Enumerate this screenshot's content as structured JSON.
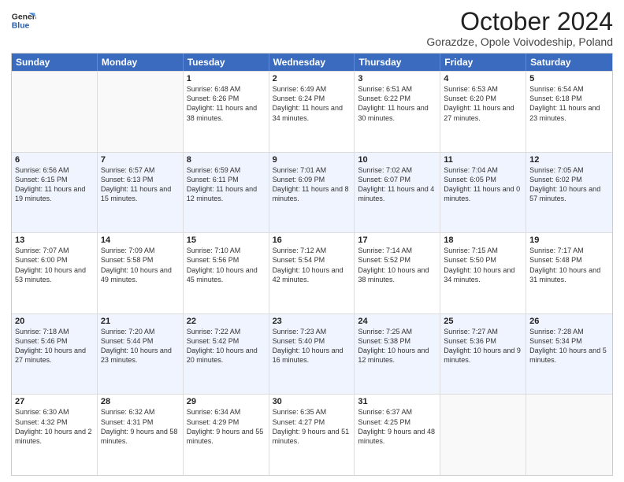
{
  "header": {
    "logo_line1": "General",
    "logo_line2": "Blue",
    "title": "October 2024",
    "subtitle": "Gorazdze, Opole Voivodeship, Poland"
  },
  "days_of_week": [
    "Sunday",
    "Monday",
    "Tuesday",
    "Wednesday",
    "Thursday",
    "Friday",
    "Saturday"
  ],
  "weeks": [
    [
      {
        "day": "",
        "info": ""
      },
      {
        "day": "",
        "info": ""
      },
      {
        "day": "1",
        "info": "Sunrise: 6:48 AM\nSunset: 6:26 PM\nDaylight: 11 hours and 38 minutes."
      },
      {
        "day": "2",
        "info": "Sunrise: 6:49 AM\nSunset: 6:24 PM\nDaylight: 11 hours and 34 minutes."
      },
      {
        "day": "3",
        "info": "Sunrise: 6:51 AM\nSunset: 6:22 PM\nDaylight: 11 hours and 30 minutes."
      },
      {
        "day": "4",
        "info": "Sunrise: 6:53 AM\nSunset: 6:20 PM\nDaylight: 11 hours and 27 minutes."
      },
      {
        "day": "5",
        "info": "Sunrise: 6:54 AM\nSunset: 6:18 PM\nDaylight: 11 hours and 23 minutes."
      }
    ],
    [
      {
        "day": "6",
        "info": "Sunrise: 6:56 AM\nSunset: 6:15 PM\nDaylight: 11 hours and 19 minutes."
      },
      {
        "day": "7",
        "info": "Sunrise: 6:57 AM\nSunset: 6:13 PM\nDaylight: 11 hours and 15 minutes."
      },
      {
        "day": "8",
        "info": "Sunrise: 6:59 AM\nSunset: 6:11 PM\nDaylight: 11 hours and 12 minutes."
      },
      {
        "day": "9",
        "info": "Sunrise: 7:01 AM\nSunset: 6:09 PM\nDaylight: 11 hours and 8 minutes."
      },
      {
        "day": "10",
        "info": "Sunrise: 7:02 AM\nSunset: 6:07 PM\nDaylight: 11 hours and 4 minutes."
      },
      {
        "day": "11",
        "info": "Sunrise: 7:04 AM\nSunset: 6:05 PM\nDaylight: 11 hours and 0 minutes."
      },
      {
        "day": "12",
        "info": "Sunrise: 7:05 AM\nSunset: 6:02 PM\nDaylight: 10 hours and 57 minutes."
      }
    ],
    [
      {
        "day": "13",
        "info": "Sunrise: 7:07 AM\nSunset: 6:00 PM\nDaylight: 10 hours and 53 minutes."
      },
      {
        "day": "14",
        "info": "Sunrise: 7:09 AM\nSunset: 5:58 PM\nDaylight: 10 hours and 49 minutes."
      },
      {
        "day": "15",
        "info": "Sunrise: 7:10 AM\nSunset: 5:56 PM\nDaylight: 10 hours and 45 minutes."
      },
      {
        "day": "16",
        "info": "Sunrise: 7:12 AM\nSunset: 5:54 PM\nDaylight: 10 hours and 42 minutes."
      },
      {
        "day": "17",
        "info": "Sunrise: 7:14 AM\nSunset: 5:52 PM\nDaylight: 10 hours and 38 minutes."
      },
      {
        "day": "18",
        "info": "Sunrise: 7:15 AM\nSunset: 5:50 PM\nDaylight: 10 hours and 34 minutes."
      },
      {
        "day": "19",
        "info": "Sunrise: 7:17 AM\nSunset: 5:48 PM\nDaylight: 10 hours and 31 minutes."
      }
    ],
    [
      {
        "day": "20",
        "info": "Sunrise: 7:18 AM\nSunset: 5:46 PM\nDaylight: 10 hours and 27 minutes."
      },
      {
        "day": "21",
        "info": "Sunrise: 7:20 AM\nSunset: 5:44 PM\nDaylight: 10 hours and 23 minutes."
      },
      {
        "day": "22",
        "info": "Sunrise: 7:22 AM\nSunset: 5:42 PM\nDaylight: 10 hours and 20 minutes."
      },
      {
        "day": "23",
        "info": "Sunrise: 7:23 AM\nSunset: 5:40 PM\nDaylight: 10 hours and 16 minutes."
      },
      {
        "day": "24",
        "info": "Sunrise: 7:25 AM\nSunset: 5:38 PM\nDaylight: 10 hours and 12 minutes."
      },
      {
        "day": "25",
        "info": "Sunrise: 7:27 AM\nSunset: 5:36 PM\nDaylight: 10 hours and 9 minutes."
      },
      {
        "day": "26",
        "info": "Sunrise: 7:28 AM\nSunset: 5:34 PM\nDaylight: 10 hours and 5 minutes."
      }
    ],
    [
      {
        "day": "27",
        "info": "Sunrise: 6:30 AM\nSunset: 4:32 PM\nDaylight: 10 hours and 2 minutes."
      },
      {
        "day": "28",
        "info": "Sunrise: 6:32 AM\nSunset: 4:31 PM\nDaylight: 9 hours and 58 minutes."
      },
      {
        "day": "29",
        "info": "Sunrise: 6:34 AM\nSunset: 4:29 PM\nDaylight: 9 hours and 55 minutes."
      },
      {
        "day": "30",
        "info": "Sunrise: 6:35 AM\nSunset: 4:27 PM\nDaylight: 9 hours and 51 minutes."
      },
      {
        "day": "31",
        "info": "Sunrise: 6:37 AM\nSunset: 4:25 PM\nDaylight: 9 hours and 48 minutes."
      },
      {
        "day": "",
        "info": ""
      },
      {
        "day": "",
        "info": ""
      }
    ]
  ]
}
